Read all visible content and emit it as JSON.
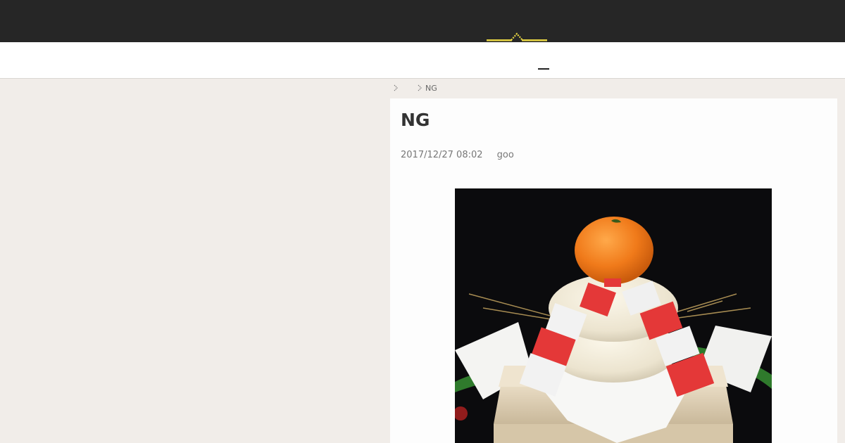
{
  "header": {
    "logo_icon": "mountain-logo-icon",
    "accent_color": "#e8d543",
    "background_color": "#262626"
  },
  "nav": {
    "menu_icon": "menu-dash-icon"
  },
  "breadcrumb": {
    "items": [
      {
        "label": ""
      },
      {
        "label": "NG"
      }
    ]
  },
  "article": {
    "title": "NG",
    "date": "2017/12/27 08:02",
    "category": "goo",
    "image_icon": "kagami-mochi-photo"
  }
}
